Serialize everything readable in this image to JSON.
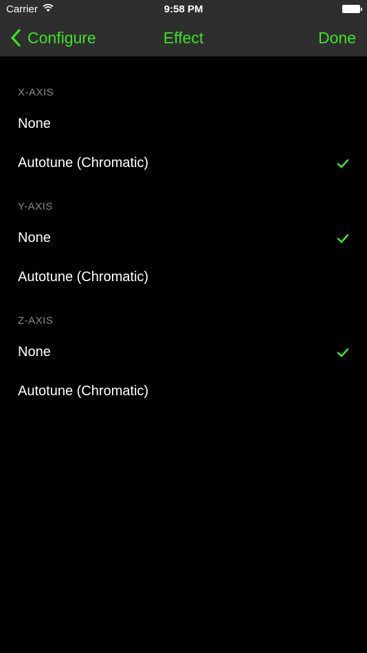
{
  "theme": {
    "accent": "#39e623",
    "background": "#000000",
    "bar": "#2e2e2e",
    "header_text": "#8a8a8a"
  },
  "status_bar": {
    "carrier": "Carrier",
    "time": "9:58 PM"
  },
  "nav": {
    "back_label": "Configure",
    "title": "Effect",
    "done_label": "Done"
  },
  "sections": [
    {
      "header": "X-AXIS",
      "rows": [
        {
          "label": "None",
          "checked": false
        },
        {
          "label": "Autotune (Chromatic)",
          "checked": true
        }
      ]
    },
    {
      "header": "Y-AXIS",
      "rows": [
        {
          "label": "None",
          "checked": true
        },
        {
          "label": "Autotune (Chromatic)",
          "checked": false
        }
      ]
    },
    {
      "header": "Z-AXIS",
      "rows": [
        {
          "label": "None",
          "checked": true
        },
        {
          "label": "Autotune (Chromatic)",
          "checked": false
        }
      ]
    }
  ]
}
